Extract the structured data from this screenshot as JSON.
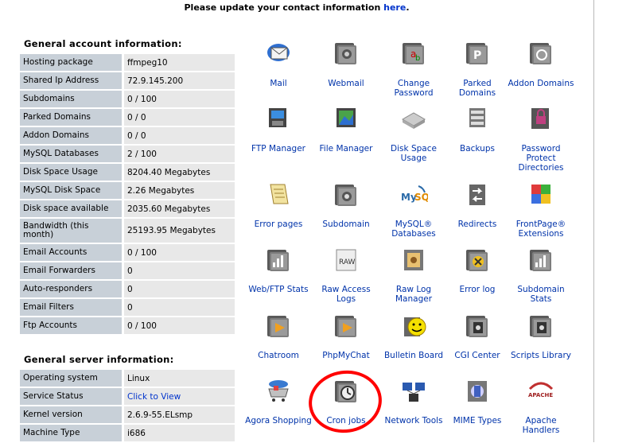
{
  "notice": {
    "text": "Please update your contact information ",
    "link": "here",
    "after": "."
  },
  "account": {
    "title": "General account information:",
    "rows": [
      {
        "k": "Hosting package",
        "v": "ffmpeg10"
      },
      {
        "k": "Shared Ip Address",
        "v": "72.9.145.200"
      },
      {
        "k": "Subdomains",
        "v": "0 / 100"
      },
      {
        "k": "Parked Domains",
        "v": "0 / 0"
      },
      {
        "k": "Addon Domains",
        "v": "0 / 0"
      },
      {
        "k": "MySQL Databases",
        "v": "2 / 100"
      },
      {
        "k": "Disk Space Usage",
        "v": "8204.40 Megabytes"
      },
      {
        "k": "MySQL Disk Space",
        "v": "2.26 Megabytes"
      },
      {
        "k": "Disk space available",
        "v": "2035.60 Megabytes"
      },
      {
        "k": "Bandwidth (this month)",
        "v": "25193.95 Megabytes"
      },
      {
        "k": "Email Accounts",
        "v": "0 / 100"
      },
      {
        "k": "Email Forwarders",
        "v": "0"
      },
      {
        "k": "Auto-responders",
        "v": "0"
      },
      {
        "k": "Email Filters",
        "v": "0"
      },
      {
        "k": "Ftp Accounts",
        "v": "0 / 100"
      }
    ]
  },
  "server": {
    "title": "General server information:",
    "rows": [
      {
        "k": "Operating system",
        "v": "Linux"
      },
      {
        "k": "Service Status",
        "v": "Click to View"
      },
      {
        "k": "Kernel version",
        "v": "2.6.9-55.ELsmp"
      },
      {
        "k": "Machine Type",
        "v": "i686"
      }
    ]
  },
  "icons": [
    {
      "label": "Mail",
      "icon": "mail-icon"
    },
    {
      "label": "Webmail",
      "icon": "webmail-icon"
    },
    {
      "label": "Change Password",
      "icon": "password-icon"
    },
    {
      "label": "Parked Domains",
      "icon": "parked-domains-icon"
    },
    {
      "label": "Addon Domains",
      "icon": "addon-domains-icon"
    },
    {
      "label": "FTP Manager",
      "icon": "ftp-icon"
    },
    {
      "label": "File Manager",
      "icon": "file-manager-icon"
    },
    {
      "label": "Disk Space Usage",
      "icon": "disk-icon"
    },
    {
      "label": "Backups",
      "icon": "backups-icon"
    },
    {
      "label": "Password Protect Directories",
      "icon": "lock-icon"
    },
    {
      "label": "Error pages",
      "icon": "error-pages-icon"
    },
    {
      "label": "Subdomain",
      "icon": "subdomain-icon"
    },
    {
      "label": "MySQL® Databases",
      "icon": "mysql-icon"
    },
    {
      "label": "Redirects",
      "icon": "redirects-icon"
    },
    {
      "label": "FrontPage® Extensions",
      "icon": "frontpage-icon"
    },
    {
      "label": "Web/FTP Stats",
      "icon": "stats-icon"
    },
    {
      "label": "Raw Access Logs",
      "icon": "raw-logs-icon"
    },
    {
      "label": "Raw Log Manager",
      "icon": "log-manager-icon"
    },
    {
      "label": "Error log",
      "icon": "error-log-icon"
    },
    {
      "label": "Subdomain Stats",
      "icon": "subdomain-stats-icon"
    },
    {
      "label": "Chatroom",
      "icon": "chatroom-icon"
    },
    {
      "label": "PhpMyChat",
      "icon": "phpmychat-icon"
    },
    {
      "label": "Bulletin Board",
      "icon": "smiley-icon"
    },
    {
      "label": "CGI Center",
      "icon": "cgi-icon"
    },
    {
      "label": "Scripts Library",
      "icon": "scripts-icon"
    },
    {
      "label": "Agora Shopping",
      "icon": "cart-icon"
    },
    {
      "label": "Cron jobs",
      "icon": "clock-icon"
    },
    {
      "label": "Network Tools",
      "icon": "network-icon"
    },
    {
      "label": "MIME Types",
      "icon": "mime-icon"
    },
    {
      "label": "Apache Handlers",
      "icon": "apache-icon"
    }
  ],
  "apache_logo_text": "APACHE",
  "raw_text": "RAW",
  "mysql_text": "MySQL"
}
